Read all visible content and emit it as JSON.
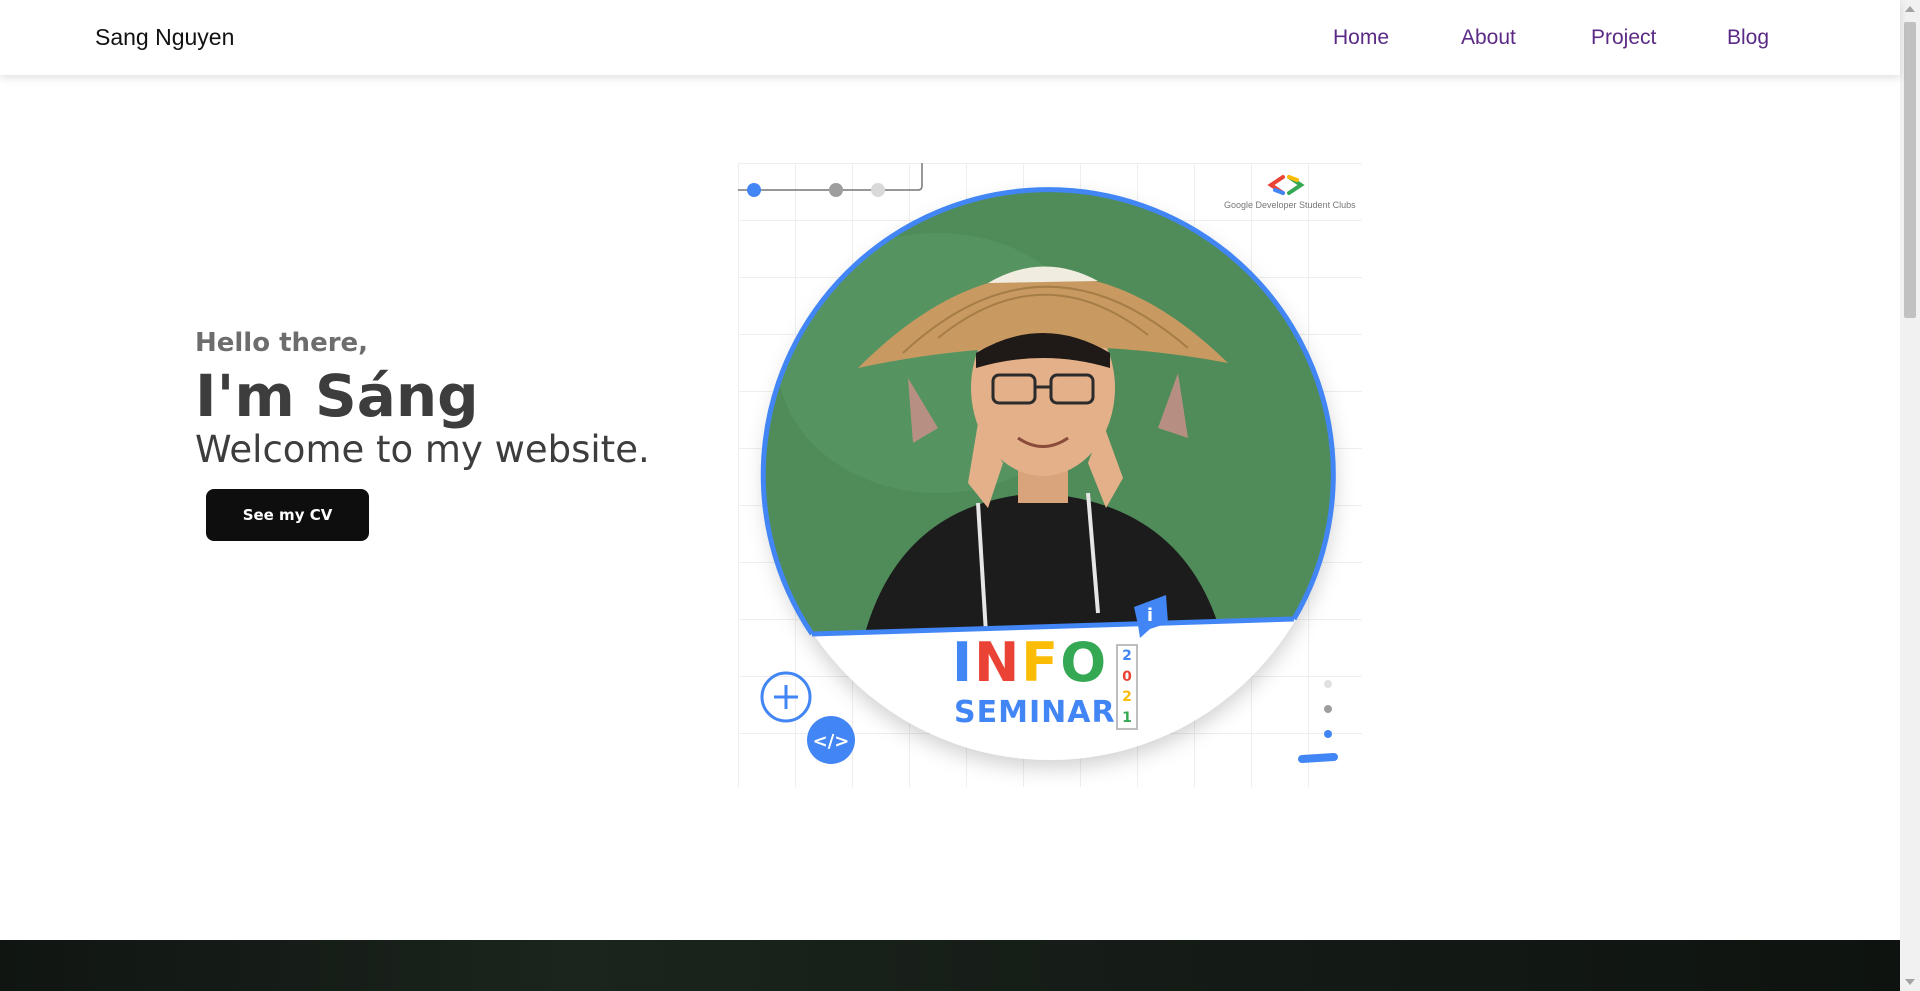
{
  "navbar": {
    "brand": "Sang Nguyen",
    "links": [
      {
        "label": "Home"
      },
      {
        "label": "About"
      },
      {
        "label": "Project"
      },
      {
        "label": "Blog"
      }
    ]
  },
  "hero": {
    "greeting": "Hello there,",
    "headline": "I'm Sáng",
    "welcome": "Welcome to my website.",
    "cv_button": "See my CV"
  },
  "profile_card": {
    "club_caption": "Google Developer Student Clubs",
    "info_letters": [
      {
        "char": "I",
        "color": "#4285f4"
      },
      {
        "char": "N",
        "color": "#ea4335"
      },
      {
        "char": "F",
        "color": "#fbbc05"
      },
      {
        "char": "O",
        "color": "#34a853"
      }
    ],
    "seminar": "SEMINAR",
    "year_digits": [
      {
        "char": "2",
        "color": "#4285f4"
      },
      {
        "char": "0",
        "color": "#ea4335"
      },
      {
        "char": "2",
        "color": "#fbbc05"
      },
      {
        "char": "1",
        "color": "#34a853"
      }
    ],
    "code_badge": "</>",
    "info_badge": "i"
  },
  "colors": {
    "nav_link": "#5b2a86",
    "google_blue": "#4285f4",
    "photo_bg": "#4f8c5a",
    "button_bg": "#0e0e0e"
  }
}
